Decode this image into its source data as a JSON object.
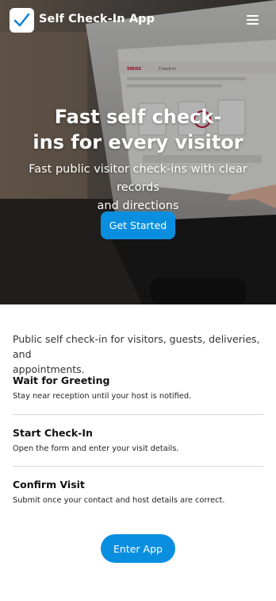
{
  "header": {
    "app_title": "Self Check-In App",
    "logo_icon": "checkmark-icon",
    "menu_icon": "hamburger-menu-icon"
  },
  "hero": {
    "heading_line1": "Fast self check-",
    "heading_line2": "ins for every visitor",
    "subtitle_line1": "Fast public visitor check-ins with clear records",
    "subtitle_line2": "and directions",
    "cta_label": "Get Started",
    "image_sign_brand": "SWISS",
    "image_sign_title": "Check-In"
  },
  "main": {
    "intro_line1": "Public self check-in for visitors, guests, deliveries, and",
    "intro_line2": "appointments.",
    "steps": [
      {
        "title": "Wait for Greeting",
        "description": "Stay near reception until your host is notified."
      },
      {
        "title": "Start Check-In",
        "description": "Open the form and enter your visit details."
      },
      {
        "title": "Confirm Visit",
        "description": "Submit once your contact and host details are correct."
      }
    ],
    "enter_label": "Enter App"
  },
  "colors": {
    "accent": "#0a8fe0",
    "text": "#1f1f1f",
    "divider": "#d9d9d9"
  }
}
